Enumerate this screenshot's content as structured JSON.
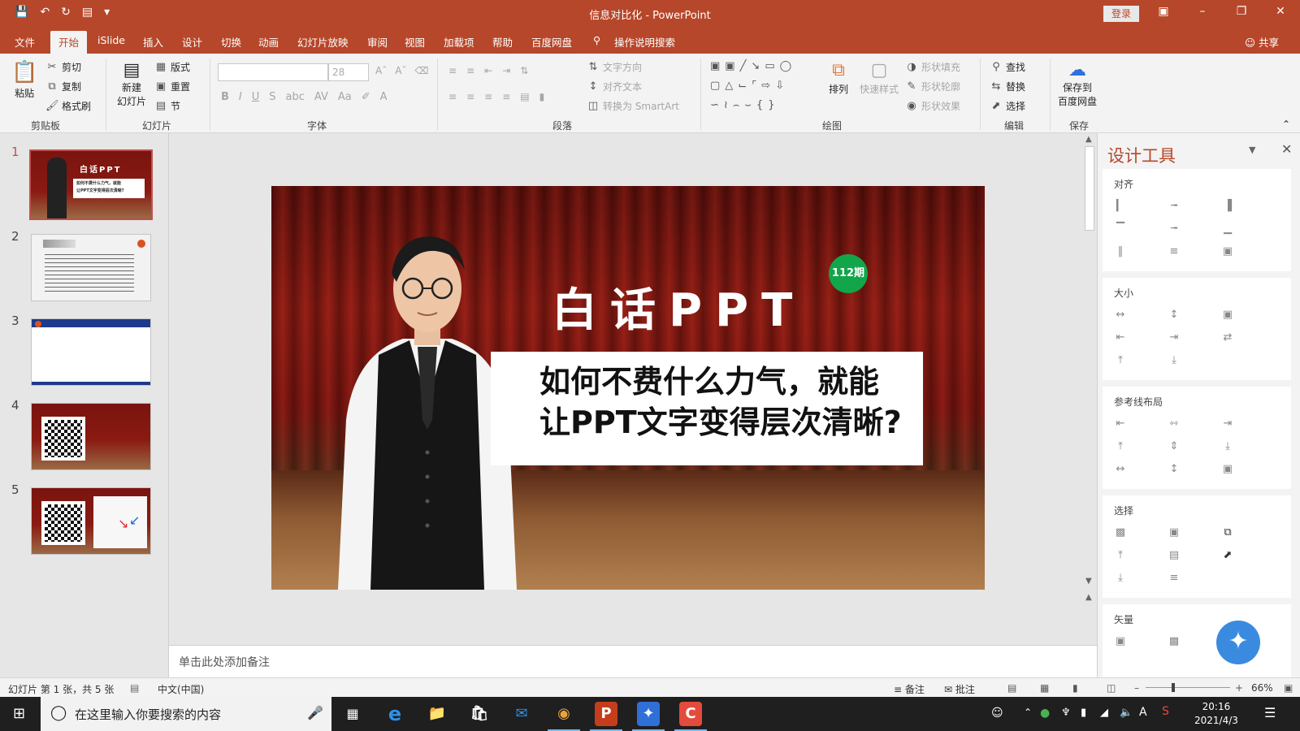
{
  "window": {
    "title": "信息对比化 - PowerPoint",
    "login_label": "登录",
    "share_label": "共享"
  },
  "tabs": [
    "文件",
    "开始",
    "iSlide",
    "插入",
    "设计",
    "切换",
    "动画",
    "幻灯片放映",
    "审阅",
    "视图",
    "加载项",
    "帮助",
    "百度网盘"
  ],
  "active_tab": "开始",
  "search_hint": "操作说明搜索",
  "ribbon": {
    "clipboard": {
      "paste": "粘贴",
      "cut": "剪切",
      "copy": "复制",
      "format_painter": "格式刷",
      "label": "剪贴板"
    },
    "slides": {
      "new_slide_line1": "新建",
      "new_slide_line2": "幻灯片",
      "layout": "版式",
      "reset": "重置",
      "section": "节",
      "label": "幻灯片"
    },
    "font": {
      "name": "",
      "size": "28",
      "label": "字体"
    },
    "paragraph": {
      "text_direction": "文字方向",
      "align_text": "对齐文本",
      "convert_smartart": "转换为 SmartArt",
      "label": "段落"
    },
    "drawing": {
      "arrange": "排列",
      "quick_styles": "快速样式",
      "shape_fill": "形状填充",
      "shape_outline": "形状轮廓",
      "shape_effects": "形状效果",
      "label": "绘图"
    },
    "editing": {
      "find": "查找",
      "replace": "替换",
      "select": "选择",
      "label": "编辑"
    },
    "save": {
      "save_baidu_line1": "保存到",
      "save_baidu_line2": "百度网盘",
      "label": "保存"
    }
  },
  "thumbnails": [
    {
      "num": "1",
      "selected": true
    },
    {
      "num": "2",
      "selected": false
    },
    {
      "num": "3",
      "selected": false
    },
    {
      "num": "4",
      "selected": false
    },
    {
      "num": "5",
      "selected": false
    }
  ],
  "slide": {
    "title": "白话PPT",
    "badge": "112期",
    "line1": "如何不费什么力气，就能",
    "line2": "让PPT文字变得层次清晰?"
  },
  "thumb1": {
    "title": "白话PPT",
    "line1": "如何不费什么力气，就能",
    "line2": "让PPT文字变得层次清晰?"
  },
  "notes_placeholder": "单击此处添加备注",
  "design_pane": {
    "title": "设计工具",
    "sections": [
      "对齐",
      "大小",
      "参考线布局",
      "选择",
      "矢量"
    ]
  },
  "status": {
    "slide_info": "幻灯片 第 1 张，共 5 张",
    "language": "中文(中国)",
    "notes": "备注",
    "comments": "批注",
    "zoom": "66%"
  },
  "taskbar": {
    "search_placeholder": "在这里输入你要搜索的内容",
    "time": "20:16",
    "date": "2021/4/3",
    "ime": "A"
  }
}
